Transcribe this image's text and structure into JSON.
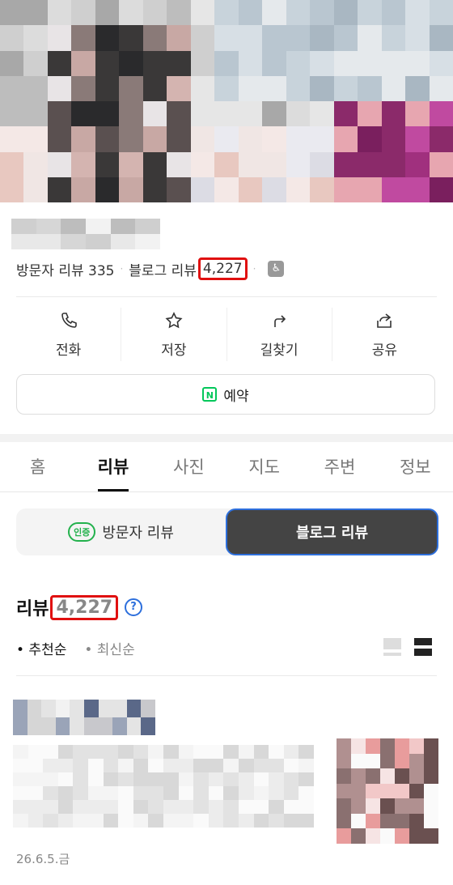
{
  "stats": {
    "visitor": "방문자 리뷰 335",
    "dot": "·",
    "blog_prefix": "블로그 리뷰",
    "blog_count": "4,227"
  },
  "actions": {
    "call": "전화",
    "save": "저장",
    "directions": "길찾기",
    "share": "공유"
  },
  "reserve": {
    "badge": "N",
    "label": "예약"
  },
  "tabs": [
    "홈",
    "리뷰",
    "사진",
    "지도",
    "주변",
    "정보"
  ],
  "segment": {
    "cert": "인증",
    "visitor": "방문자 리뷰",
    "blog": "블로그 리뷰"
  },
  "review_header": {
    "title": "리뷰",
    "count": "4,227",
    "help": "?"
  },
  "sort": {
    "recommended": "• 추천순",
    "latest": "• 최신순"
  },
  "review_date": "26.6.5.금",
  "colors": {
    "accent_red": "#e01010",
    "naver_green": "#03c75a",
    "active_blue": "#2d6fdc",
    "dark": "#444444"
  }
}
